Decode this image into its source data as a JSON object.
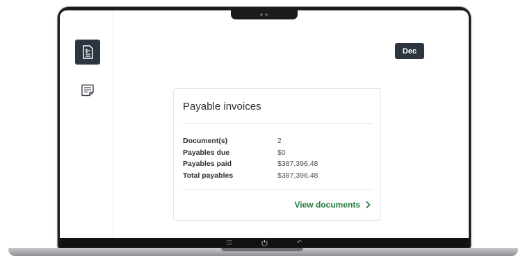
{
  "header": {
    "month_label": "Dec"
  },
  "sidebar": {
    "items": [
      {
        "icon": "invoice-dollar-icon",
        "active": true
      },
      {
        "icon": "notes-icon",
        "active": false
      }
    ]
  },
  "card": {
    "title": "Payable invoices",
    "rows": [
      {
        "label": "Document(s)",
        "value": "2"
      },
      {
        "label": "Payables due",
        "value": "$0"
      },
      {
        "label": "Payables paid",
        "value": "$387,396.48"
      },
      {
        "label": "Total payables",
        "value": "$387,396.48"
      }
    ],
    "link_label": "View documents"
  },
  "colors": {
    "accent_dark": "#2d3640",
    "link_green": "#1f7a3a"
  }
}
